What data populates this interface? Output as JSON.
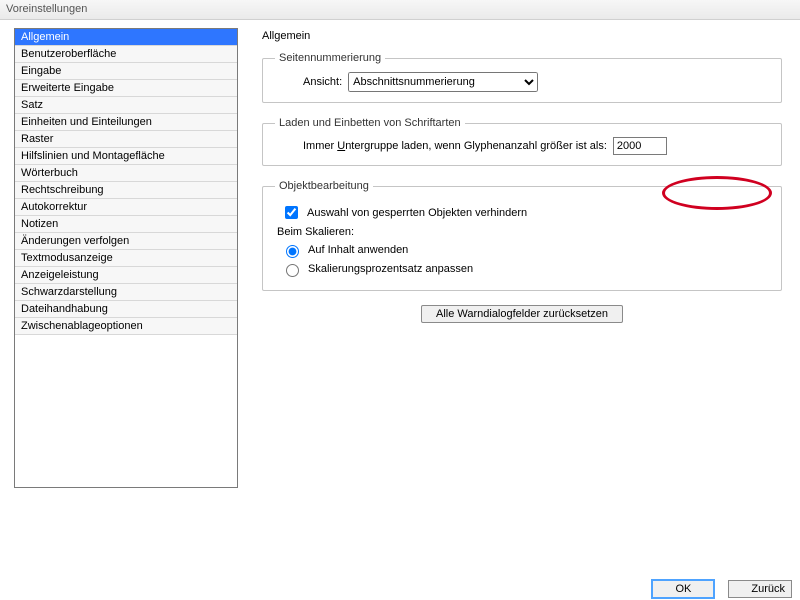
{
  "window": {
    "title": "Voreinstellungen"
  },
  "sidebar": {
    "items": [
      "Allgemein",
      "Benutzeroberfläche",
      "Eingabe",
      "Erweiterte Eingabe",
      "Satz",
      "Einheiten und Einteilungen",
      "Raster",
      "Hilfslinien und Montagefläche",
      "Wörterbuch",
      "Rechtschreibung",
      "Autokorrektur",
      "Notizen",
      "Änderungen verfolgen",
      "Textmodusanzeige",
      "Anzeigeleistung",
      "Schwarzdarstellung",
      "Dateihandhabung",
      "Zwischenablageoptionen"
    ],
    "selected_index": 0
  },
  "main": {
    "title": "Allgemein",
    "page_numbering": {
      "legend": "Seitennummerierung",
      "view_label": "Ansicht:",
      "view_value": "Abschnittsnummerierung"
    },
    "font_loading": {
      "legend": "Laden und Einbetten von Schriftarten",
      "subset_prefix": "Immer ",
      "subset_underlined": "U",
      "subset_rest": "ntergruppe laden, wenn Glyphenanzahl größer ist als:",
      "subset_value": "2000"
    },
    "object_editing": {
      "legend": "Objektbearbeitung",
      "prevent_locked_label": "Auswahl von gesperrten Objekten verhindern",
      "prevent_locked_checked": true,
      "scaling_label": "Beim Skalieren:",
      "radio_content": "Auf Inhalt anwenden",
      "radio_percent": "Skalierungsprozentsatz anpassen",
      "radio_selected": "content"
    },
    "reset_button": "Alle Warndialogfelder zurücksetzen"
  },
  "footer": {
    "ok": "OK",
    "back": "Zurück"
  }
}
